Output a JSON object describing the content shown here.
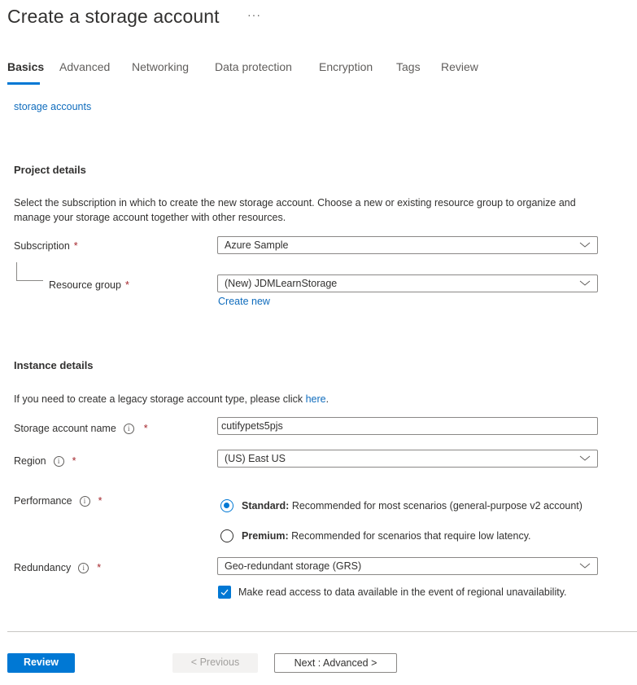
{
  "header": {
    "title": "Create a storage account",
    "more_label": "···"
  },
  "tabs": [
    {
      "label": "Basics",
      "active": true
    },
    {
      "label": "Advanced",
      "active": false
    },
    {
      "label": "Networking",
      "active": false
    },
    {
      "label": "Data protection",
      "active": false
    },
    {
      "label": "Encryption",
      "active": false
    },
    {
      "label": "Tags",
      "active": false
    },
    {
      "label": "Review",
      "active": false
    }
  ],
  "top_link": "storage accounts",
  "project_details": {
    "title": "Project details",
    "description": "Select the subscription in which to create the new storage account. Choose a new or existing resource group to organize and manage your storage account together with other resources.",
    "subscription": {
      "label": "Subscription",
      "required": "*",
      "value": "Azure Sample"
    },
    "resource_group": {
      "label": "Resource group",
      "required": "*",
      "value": "(New) JDMLearnStorage",
      "create_new_link": "Create new"
    }
  },
  "instance_details": {
    "title": "Instance details",
    "legacy_text": "If you need to create a legacy storage account type, please click",
    "legacy_link": "here",
    "legacy_suffix": ".",
    "storage_account_name": {
      "label": "Storage account name",
      "required": "*",
      "value": "cutifypets5pjs",
      "info_icon": "info-icon"
    },
    "region": {
      "label": "Region",
      "required": "*",
      "value": "(US) East US",
      "info_icon": "info-icon"
    },
    "performance": {
      "label": "Performance",
      "required": "*",
      "info_icon": "info-icon",
      "options": [
        {
          "name": "Standard:",
          "description": "Recommended for most scenarios (general-purpose v2 account)",
          "selected": true
        },
        {
          "name": "Premium:",
          "description": "Recommended for scenarios that require low latency.",
          "selected": false
        }
      ]
    },
    "redundancy": {
      "label": "Redundancy",
      "required": "*",
      "value": "Geo-redundant storage (GRS)",
      "info_icon": "info-icon",
      "read_access_checkbox": {
        "label": "Make read access to data available in the event of regional unavailability.",
        "checked": true
      }
    }
  },
  "footer": {
    "review_button": "Review",
    "previous_button": "< Previous",
    "next_button": "Next : Advanced >"
  },
  "colors": {
    "accent": "#0078d4",
    "link": "#0f6cbd",
    "required": "#a4262c",
    "text": "#323130"
  }
}
